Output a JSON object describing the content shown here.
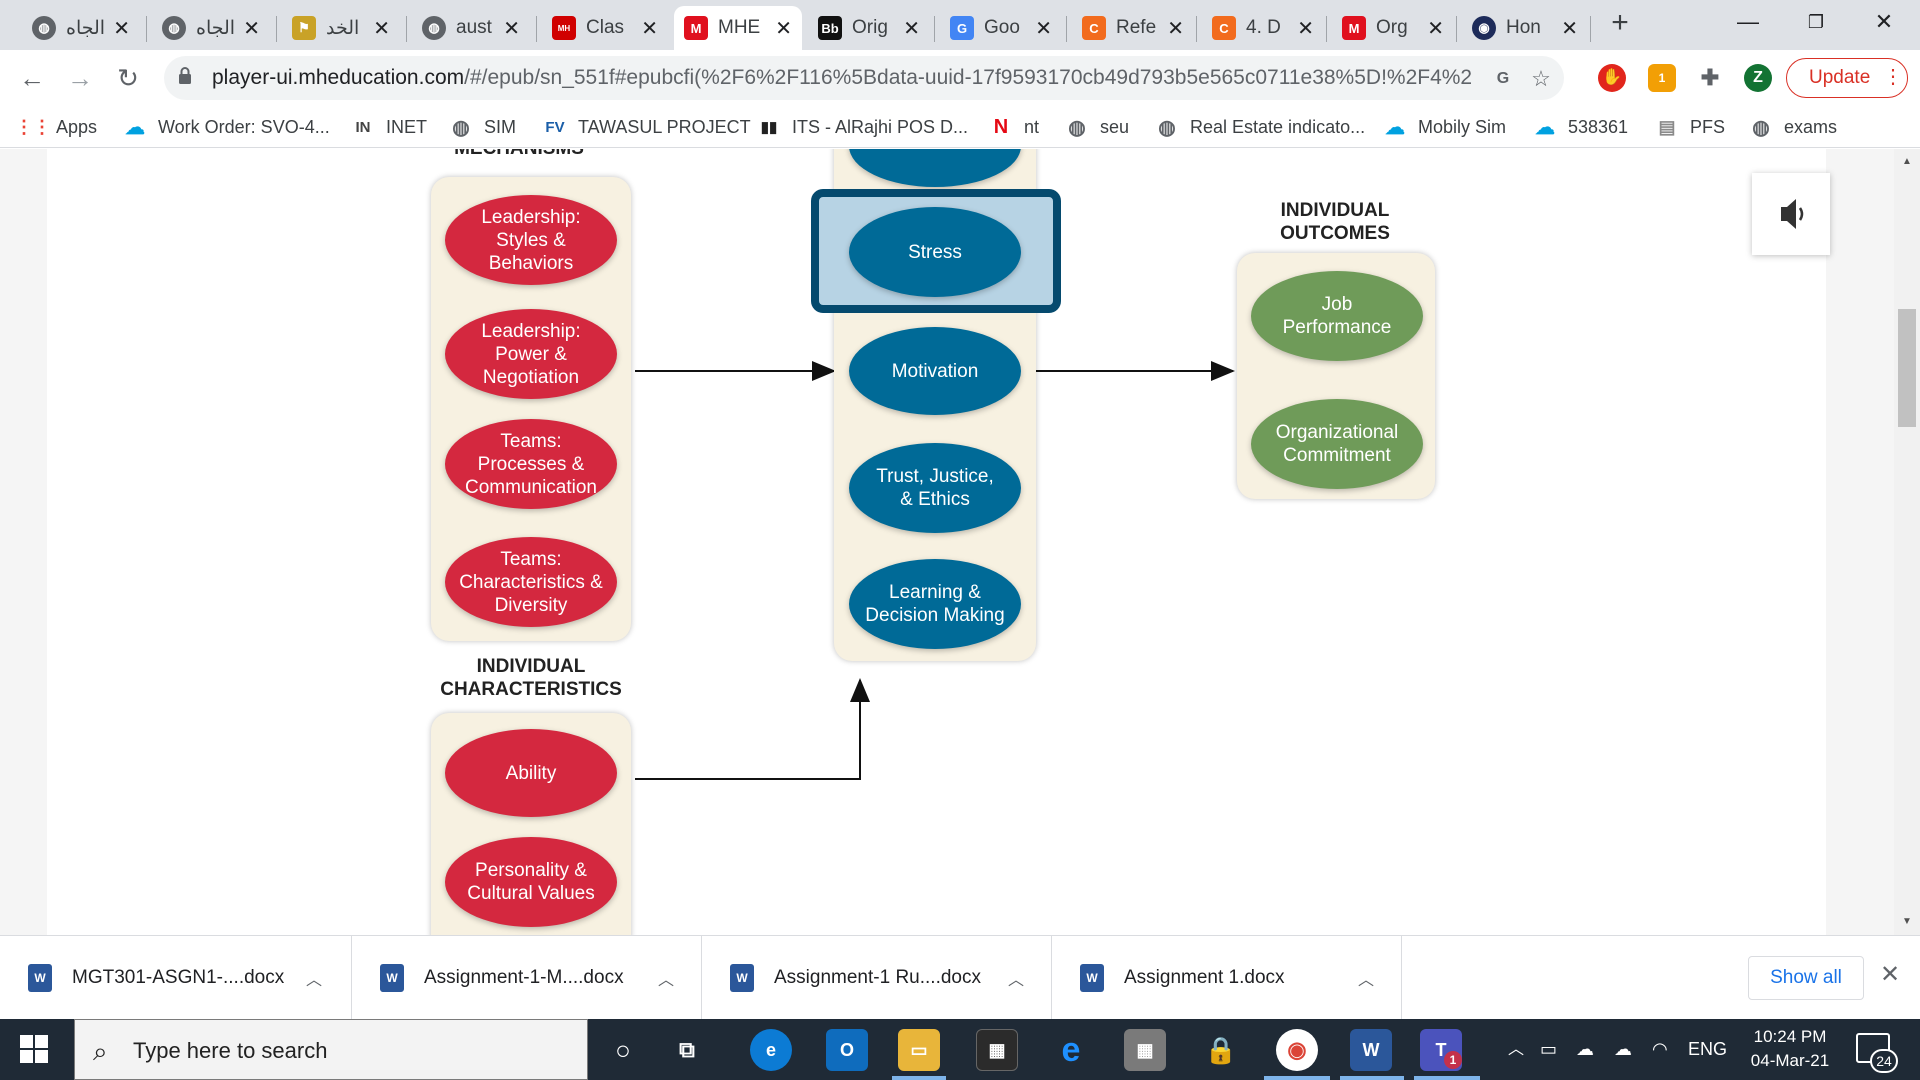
{
  "tabs": [
    {
      "title": "الجاه",
      "icon": "globe-icon"
    },
    {
      "title": "الجاه",
      "icon": "globe-icon"
    },
    {
      "title": "الخد",
      "icon": "flag-icon"
    },
    {
      "title": "aust",
      "icon": "globe-icon"
    },
    {
      "title": "Clas",
      "icon": "mcgraw-hill-icon"
    },
    {
      "title": "MHE",
      "icon": "m-logo-icon"
    },
    {
      "title": "Orig",
      "icon": "blackboard-icon"
    },
    {
      "title": "Goo",
      "icon": "google-translate-icon"
    },
    {
      "title": "Refe",
      "icon": "c-logo-icon"
    },
    {
      "title": "4. D",
      "icon": "c-logo-icon"
    },
    {
      "title": "Org",
      "icon": "m-logo-icon"
    },
    {
      "title": "Hon",
      "icon": "circle-logo-icon"
    }
  ],
  "toolbar": {
    "url_domain": "player-ui.mheducation.com",
    "url_rest": "/#/epub/sn_551f#epubcfi(%2F6%2F116%5Bdata-uuid-17f9593170cb49d793b5e565c0711e38%5D!%2F4%2...",
    "profile_initial": "Z",
    "update_label": "Update",
    "ext_badge": "1"
  },
  "bookmarks": [
    {
      "label": "Apps",
      "icon": "apps-grid-icon"
    },
    {
      "label": "Work Order: SVO-4...",
      "icon": "salesforce-cloud-icon"
    },
    {
      "label": "INET",
      "icon": "inet-icon"
    },
    {
      "label": "SIM",
      "icon": "globe-icon"
    },
    {
      "label": "TAWASUL PROJECT",
      "icon": "fv-icon"
    },
    {
      "label": "ITS - AlRajhi POS D...",
      "icon": "bar-chart-icon"
    },
    {
      "label": "nt",
      "icon": "netflix-n-icon"
    },
    {
      "label": "seu",
      "icon": "globe-icon"
    },
    {
      "label": "Real Estate indicato...",
      "icon": "globe-icon"
    },
    {
      "label": "Mobily Sim",
      "icon": "cloud-icon"
    },
    {
      "label": "538361",
      "icon": "salesforce-cloud-icon"
    },
    {
      "label": "PFS",
      "icon": "document-icon"
    },
    {
      "label": "exams",
      "icon": "globe-icon"
    }
  ],
  "diagram": {
    "top_cut_header": "MECHANISMS",
    "group_mechanisms": [
      "Leadership:\nStyles &\nBehaviors",
      "Leadership:\nPower &\nNegotiation",
      "Teams:\nProcesses &\nCommunication",
      "Teams:\nCharacteristics &\nDiversity"
    ],
    "individual_characteristics_header": "INDIVIDUAL\nCHARACTERISTICS",
    "individual_characteristics": [
      "Ability",
      "Personality &\nCultural Values"
    ],
    "individual_mechanisms": [
      "Stress",
      "Motivation",
      "Trust, Justice,\n& Ethics",
      "Learning &\nDecision Making"
    ],
    "individual_outcomes_header": "INDIVIDUAL\nOUTCOMES",
    "individual_outcomes": [
      "Job\nPerformance",
      "Organizational\nCommitment"
    ],
    "highlighted": "Stress"
  },
  "downloads": [
    {
      "name": "MGT301-ASGN1-....docx"
    },
    {
      "name": "Assignment-1-M....docx"
    },
    {
      "name": "Assignment-1 Ru....docx"
    },
    {
      "name": "Assignment 1.docx"
    }
  ],
  "downloads_show_all": "Show all",
  "taskbar": {
    "search_placeholder": "Type here to search",
    "language": "ENG",
    "time": "10:24 PM",
    "date": "04-Mar-21",
    "notification_count": "24",
    "teams_badge": "1"
  },
  "colors": {
    "red": "#d4283f",
    "blue": "#006a97",
    "green": "#6f9b59",
    "panel": "#f7f1e1",
    "highlight_border": "#054a6e",
    "highlight_fill": "#b7d3e4"
  }
}
